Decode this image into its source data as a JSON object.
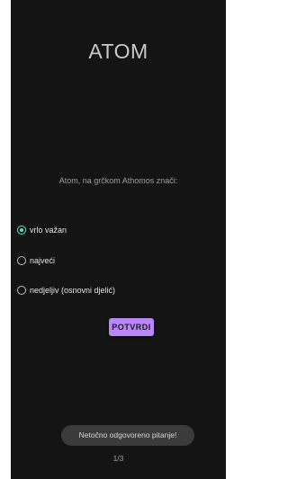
{
  "title": "ATOM",
  "question": "Atom, na grčkom Athomos znači:",
  "options": [
    {
      "label": "vrlo važan",
      "selected": true
    },
    {
      "label": "najveći",
      "selected": false
    },
    {
      "label": "nedjeljiv (osnovni djelić)",
      "selected": false
    }
  ],
  "submit_label": "POTVRDI",
  "toast": "Netočno odgovoreno pitanje!",
  "counter": "1/3",
  "colors": {
    "background": "#141414",
    "accent": "#bb86fc",
    "radio_checked": "#5de3c9"
  }
}
